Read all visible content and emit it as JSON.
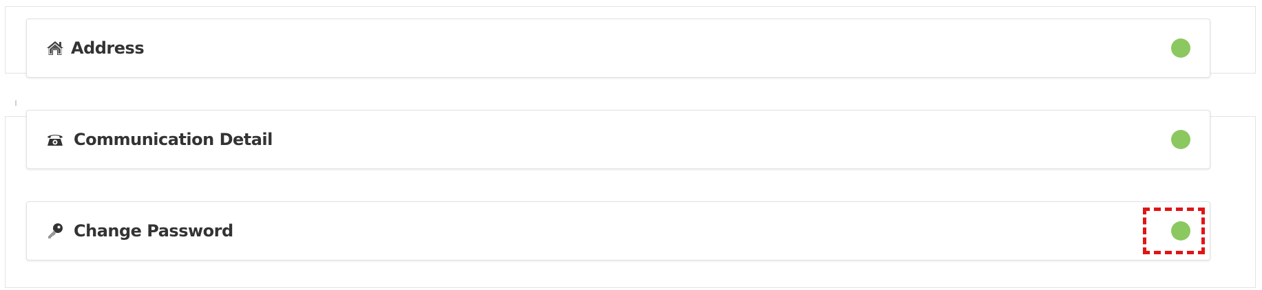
{
  "cards": [
    {
      "title": "Address",
      "icon": "home-icon",
      "status_color": "#8bc860"
    },
    {
      "title": "Communication Detail",
      "icon": "telephone-icon",
      "status_color": "#8bc860"
    },
    {
      "title": "Change Password",
      "icon": "key-icon",
      "status_color": "#8bc860"
    }
  ],
  "colors": {
    "status_green": "#8bc860",
    "highlight_red": "#e01515",
    "text": "#333333"
  }
}
